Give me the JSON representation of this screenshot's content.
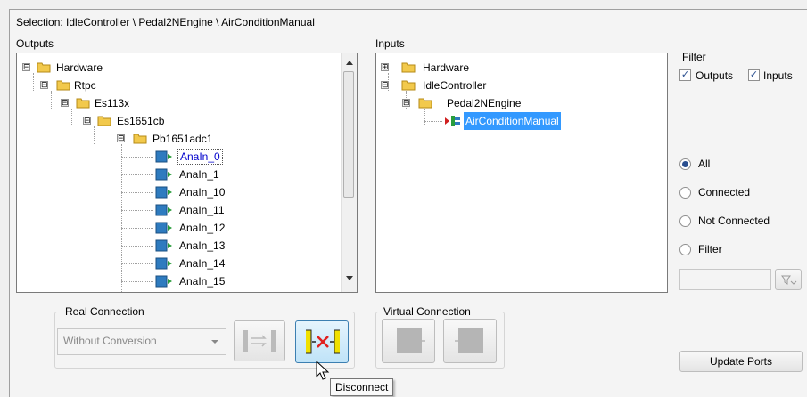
{
  "selection": "Selection: IdleController \\ Pedal2NEngine \\ AirConditionManual",
  "outputs": {
    "label": "Outputs",
    "tree": [
      {
        "label": "Hardware",
        "expander": "⊟"
      },
      {
        "label": "Rtpc",
        "expander": "⊟"
      },
      {
        "label": "Es113x",
        "expander": "⊟"
      },
      {
        "label": "Es1651cb",
        "expander": "⊟"
      },
      {
        "label": "Pb1651adc1",
        "expander": "⊟"
      },
      {
        "label": "AnaIn_0"
      },
      {
        "label": "AnaIn_1"
      },
      {
        "label": "AnaIn_10"
      },
      {
        "label": "AnaIn_11"
      },
      {
        "label": "AnaIn_12"
      },
      {
        "label": "AnaIn_13"
      },
      {
        "label": "AnaIn_14"
      },
      {
        "label": "AnaIn_15"
      }
    ]
  },
  "inputs": {
    "label": "Inputs",
    "tree": [
      {
        "label": "Hardware",
        "expander": "⊞"
      },
      {
        "label": "IdleController",
        "expander": "⊟"
      },
      {
        "label": "Pedal2NEngine",
        "expander": "⊟"
      },
      {
        "label": "AirConditionManual"
      }
    ]
  },
  "filter": {
    "title": "Filter",
    "outputs_label": "Outputs",
    "inputs_label": "Inputs",
    "outputs_checked": true,
    "inputs_checked": true,
    "options": [
      "All",
      "Connected",
      "Not Connected",
      "Filter"
    ],
    "selected": "All",
    "filter_text": ""
  },
  "real_connection": {
    "title": "Real Connection",
    "conversion": "Without Conversion"
  },
  "virtual_connection": {
    "title": "Virtual Connection"
  },
  "update_ports_label": "Update Ports",
  "tooltip": "Disconnect",
  "colors": {
    "selection_bg": "#3399ff",
    "folder": "#f2c94c",
    "port": "#2e7bbf",
    "disconnect_x": "#e02020"
  }
}
